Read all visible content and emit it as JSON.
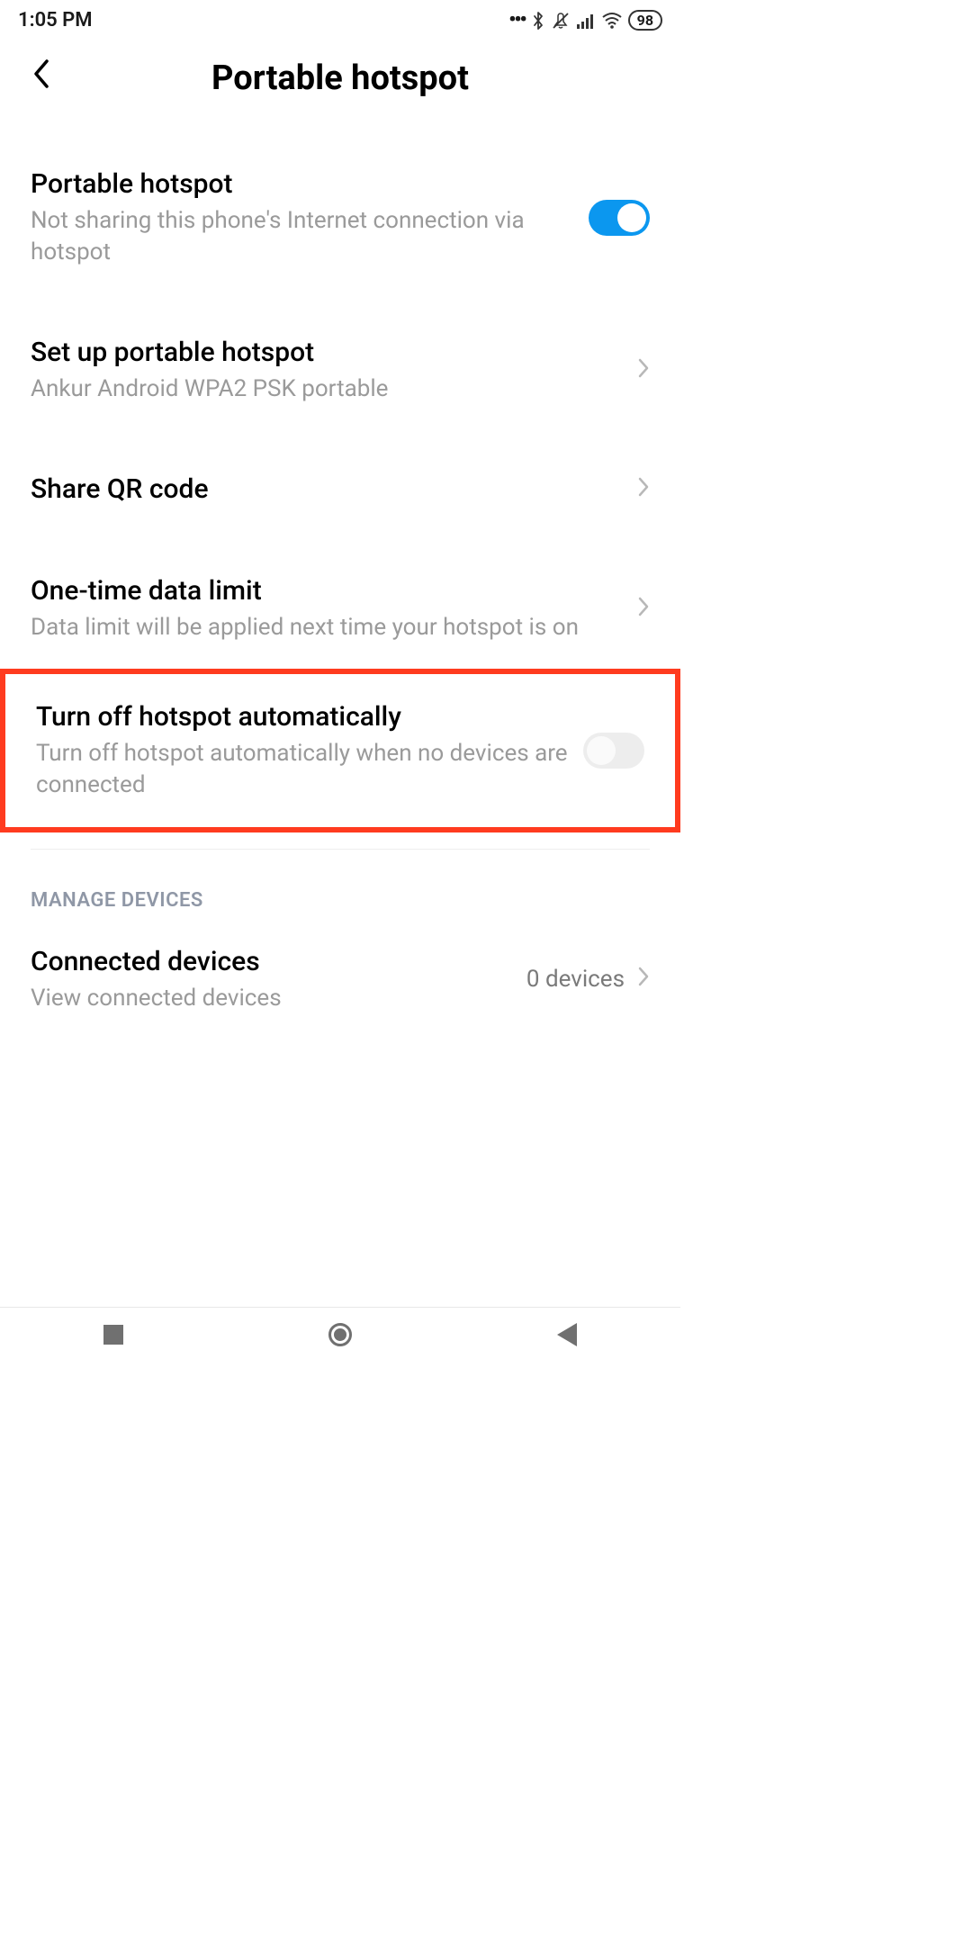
{
  "status": {
    "time": "1:05 PM",
    "battery": "98"
  },
  "header": {
    "title": "Portable hotspot"
  },
  "rows": {
    "hotspot": {
      "title": "Portable hotspot",
      "sub": "Not sharing this phone's Internet connection via hotspot"
    },
    "setup": {
      "title": "Set up portable hotspot",
      "sub": "Ankur Android WPA2 PSK portable"
    },
    "qr": {
      "title": "Share QR code"
    },
    "limit": {
      "title": "One-time data limit",
      "sub": "Data limit will be applied next time your hotspot is on"
    },
    "auto_off": {
      "title": "Turn off hotspot automatically",
      "sub": "Turn off hotspot automatically when no devices are connected"
    },
    "connected": {
      "title": "Connected devices",
      "sub": "View connected devices",
      "value": "0 devices"
    }
  },
  "sections": {
    "manage": "MANAGE DEVICES"
  },
  "icons": {
    "dots": "•••",
    "bluetooth": "bluetooth",
    "mute": "mute-vibrate",
    "signal": "signal",
    "wifi": "wifi"
  }
}
